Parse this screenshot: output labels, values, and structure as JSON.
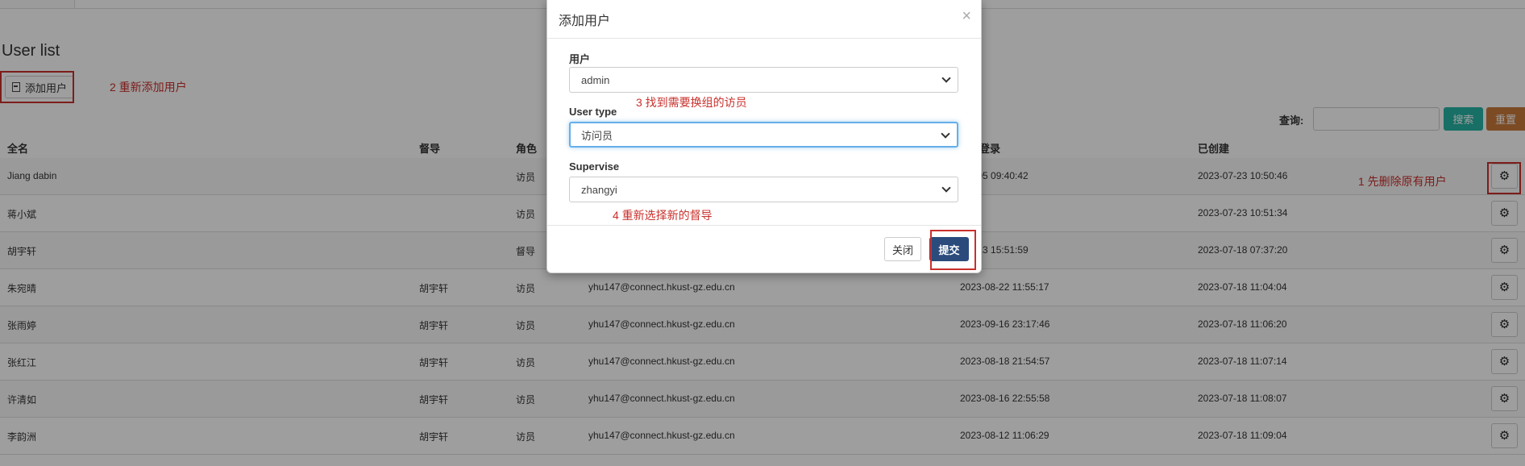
{
  "page": {
    "title": "User list",
    "add_button_label": "添加用户",
    "search_label": "查询:",
    "search_placeholder": "",
    "search_button": "搜索",
    "reset_button": "重置"
  },
  "table": {
    "headers": [
      "全名",
      "督导",
      "角色",
      "",
      "登录",
      "已创建"
    ],
    "rows": [
      {
        "name": "Jiang dabin",
        "supervisor": "",
        "role": "访员",
        "email": "",
        "login": "-08-05 09:40:42",
        "created": "2023-07-23 10:50:46"
      },
      {
        "name": "蒋小斌",
        "supervisor": "",
        "role": "访员",
        "email": "",
        "login": "",
        "created": "2023-07-23 10:51:34"
      },
      {
        "name": "胡宇轩",
        "supervisor": "",
        "role": "督导",
        "email": "",
        "login": "-09-13 15:51:59",
        "created": "2023-07-18 07:37:20"
      },
      {
        "name": "朱宛晴",
        "supervisor": "胡宇轩",
        "role": "访员",
        "email": "yhu147@connect.hkust-gz.edu.cn",
        "login": "2023-08-22 11:55:17",
        "created": "2023-07-18 11:04:04"
      },
      {
        "name": "张雨婷",
        "supervisor": "胡宇轩",
        "role": "访员",
        "email": "yhu147@connect.hkust-gz.edu.cn",
        "login": "2023-09-16 23:17:46",
        "created": "2023-07-18 11:06:20"
      },
      {
        "name": "张红江",
        "supervisor": "胡宇轩",
        "role": "访员",
        "email": "yhu147@connect.hkust-gz.edu.cn",
        "login": "2023-08-18 21:54:57",
        "created": "2023-07-18 11:07:14"
      },
      {
        "name": "许清如",
        "supervisor": "胡宇轩",
        "role": "访员",
        "email": "yhu147@connect.hkust-gz.edu.cn",
        "login": "2023-08-16 22:55:58",
        "created": "2023-07-18 11:08:07"
      },
      {
        "name": "李韵洲",
        "supervisor": "胡宇轩",
        "role": "访员",
        "email": "yhu147@connect.hkust-gz.edu.cn",
        "login": "2023-08-12 11:06:29",
        "created": "2023-07-18 11:09:04"
      }
    ]
  },
  "annotations": {
    "step1": "1 先删除原有用户",
    "step2": "2 重新添加用户",
    "step3": "3 找到需要换组的访员",
    "step4": "4 重新选择新的督导",
    "color": "#c9302c"
  },
  "modal": {
    "title": "添加用户",
    "close_symbol": "×",
    "user_label": "用户",
    "user_value": "admin",
    "user_type_label": "User type",
    "user_type_value": "访问员",
    "supervise_label": "Supervise",
    "supervise_value": "zhangyi",
    "close_button": "关闭",
    "submit_button": "提交"
  },
  "icons": {
    "row_action": "gear-icon",
    "add_user": "add-user-icon"
  },
  "colors": {
    "search_button": "#26b3a3",
    "reset_button": "#c87a3a",
    "submit_button": "#2a4b7c",
    "focus_border": "#66afe9"
  }
}
